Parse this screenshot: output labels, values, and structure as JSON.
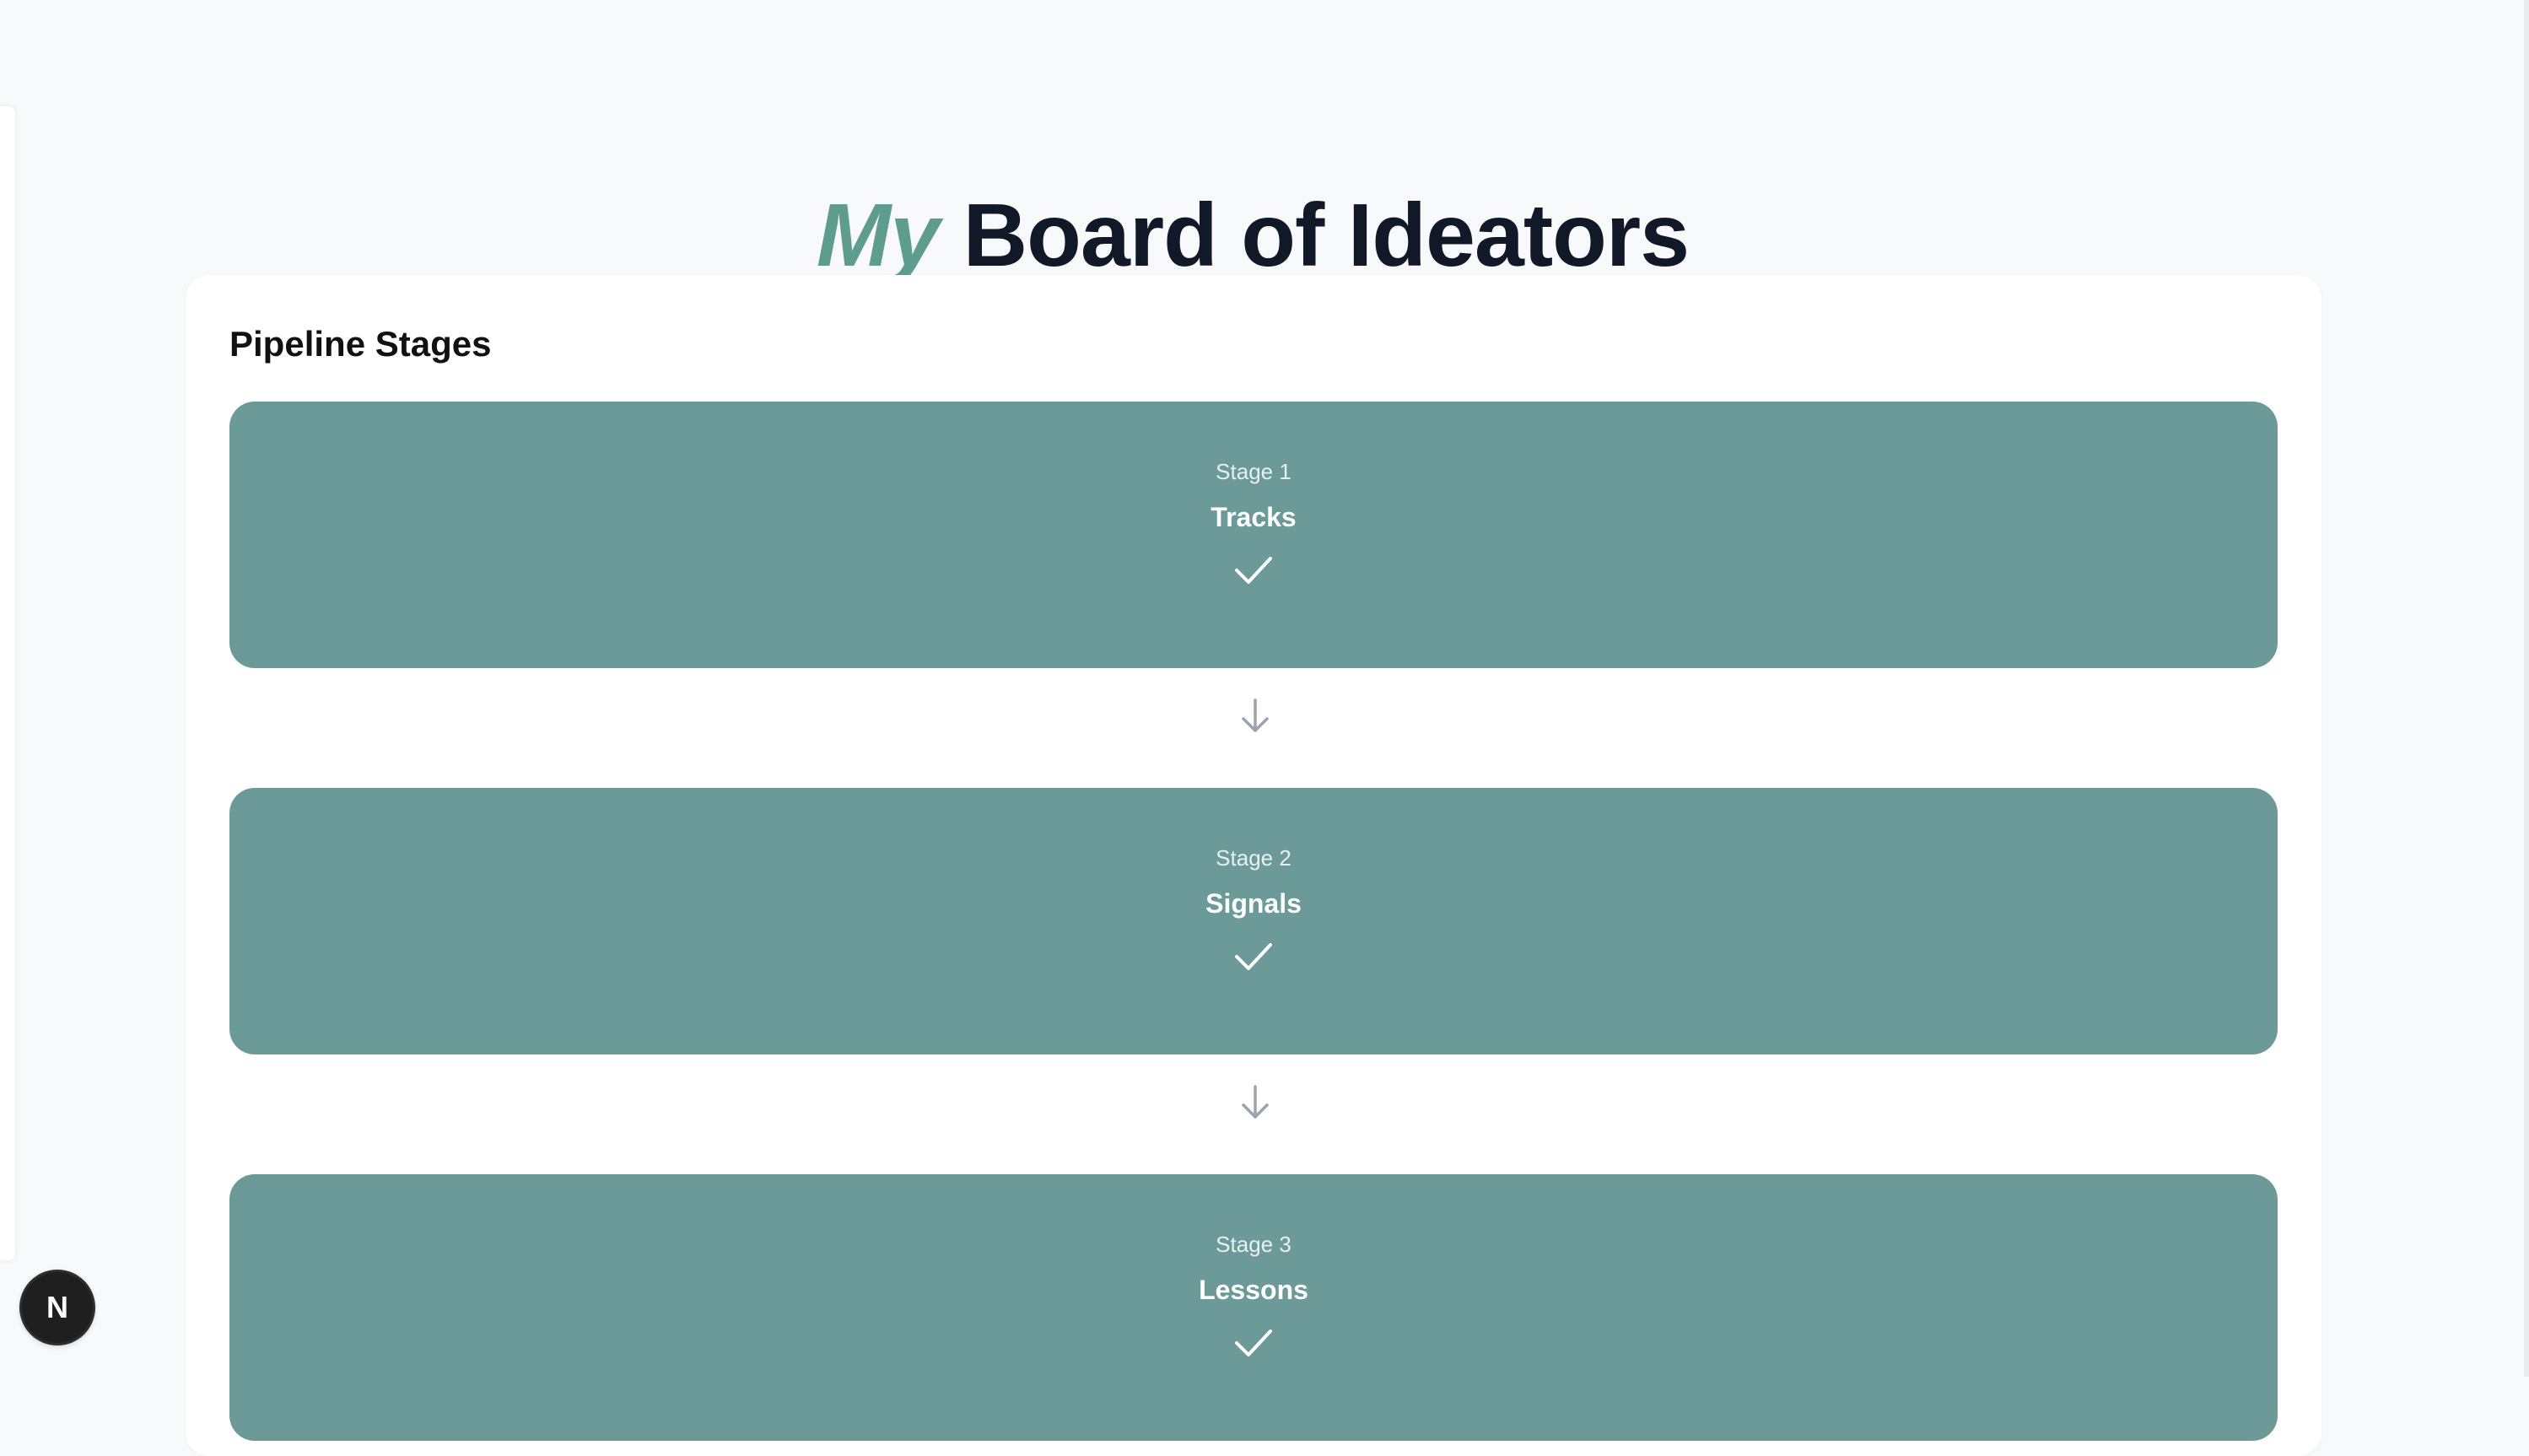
{
  "header": {
    "title_accent": "My",
    "title_rest": "Board of Ideators"
  },
  "pipeline": {
    "title": "Pipeline Stages",
    "stages": [
      {
        "label": "Stage 1",
        "name": "Tracks",
        "status_icon": "check-icon"
      },
      {
        "label": "Stage 2",
        "name": "Signals",
        "status_icon": "check-icon"
      },
      {
        "label": "Stage 3",
        "name": "Lessons",
        "status_icon": "check-icon"
      }
    ],
    "connector_icon": "arrow-down-icon"
  },
  "fab": {
    "label": "N"
  },
  "colors": {
    "accent": "#5e9c8e",
    "stage_bg": "#6b9a98",
    "title": "#111827",
    "arrow": "#9ca3af"
  }
}
